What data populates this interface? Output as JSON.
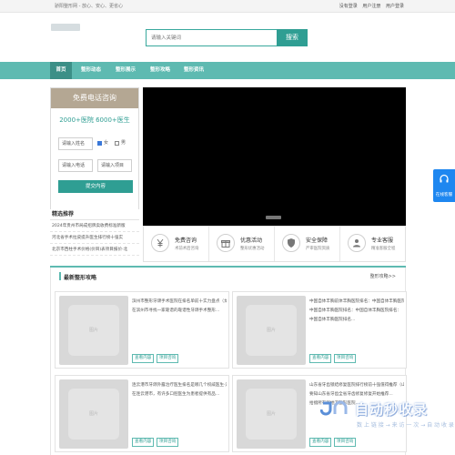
{
  "topbar": {
    "slogan": "骄阳整形网 - 放心、安心、更省心",
    "links": [
      "没有登录",
      "用户注册",
      "用户登录"
    ]
  },
  "search": {
    "placeholder": "请输入关键词",
    "button_label": "搜索"
  },
  "nav": {
    "items": [
      {
        "label": "首页",
        "active": true
      },
      {
        "label": "整形动态",
        "active": false
      },
      {
        "label": "整形展示",
        "active": false
      },
      {
        "label": "整形攻略",
        "active": false
      },
      {
        "label": "整形资讯",
        "active": false
      }
    ]
  },
  "consult": {
    "title": "免费电话咨询",
    "stat_line": "2000+医院 6000+医生",
    "name_placeholder": "请输入姓名",
    "gender_female": "女",
    "gender_male": "男",
    "phone_placeholder": "请输入电话",
    "project_placeholder": "请输入项目",
    "submit_label": "提交内容"
  },
  "recommend": {
    "title": "精选推荐",
    "items": [
      "2024年贵州市局成招牌卖收费标准新版",
      "河北省手术拉皮提升医生排行榜十强实",
      "北京市西柱手术价格(价目)表项目报价·北"
    ]
  },
  "features": [
    {
      "title": "免费咨询",
      "subtitle": "术前术后咨询",
      "icon": "yen-icon"
    },
    {
      "title": "优惠活动",
      "subtitle": "整形优惠活动",
      "icon": "gift-icon"
    },
    {
      "title": "安全保障",
      "subtitle": "严审医院资质",
      "icon": "shield-icon"
    },
    {
      "title": "专业客服",
      "subtitle": "精准客服全程",
      "icon": "user-icon"
    }
  ],
  "section": {
    "title": "最新整形攻略",
    "more": "整形攻略>>",
    "cards": [
      {
        "lines": [
          "滨州市整形牙颌手术医院在排名单前十实力盘点（龙",
          "在滨州市寻找一家靠谱的靠谱性牙颌手术整形..."
        ],
        "tags": [
          "查看内容",
          "项目咨询"
        ]
      },
      {
        "lines": [
          "中国自体丰胸前体丰胸医院排名：中国自体丰胸医院排名：",
          "中国自体丰胸医院排名：中国自体丰胸医院排名：",
          "中国自体丰胸医院排名..."
        ],
        "tags": [
          "查看内容",
          "项目咨询"
        ]
      },
      {
        "lines": [
          "连云港市牙颌外露治疗医生排名是哪几个权威医生·连云港",
          "在连云港市，有许多口腔医生为患者提供有品..."
        ],
        "tags": [
          "查看内容",
          "项目咨询"
        ]
      },
      {
        "lines": [
          "山东省牙齿锁结修复医院排行榜前十强值得推荐（山东牙齿",
          "要知山东省牙齿全省牙齿修复修复开始推荐...",
          "拾掇所有的地方整形医院..."
        ],
        "tags": [
          "查看内容",
          "项目咨询"
        ]
      }
    ]
  },
  "side_service": {
    "label": "在线客服"
  },
  "watermark": {
    "main": "自动秒收录",
    "sub": "数 上 链 接 → 来 访 一 次 → 自 动 收 录"
  },
  "colors": {
    "teal": "#5ebab1",
    "teal_dark": "#2f9e93",
    "consult_header": "#b4a793",
    "service_blue": "#1e87f0"
  }
}
